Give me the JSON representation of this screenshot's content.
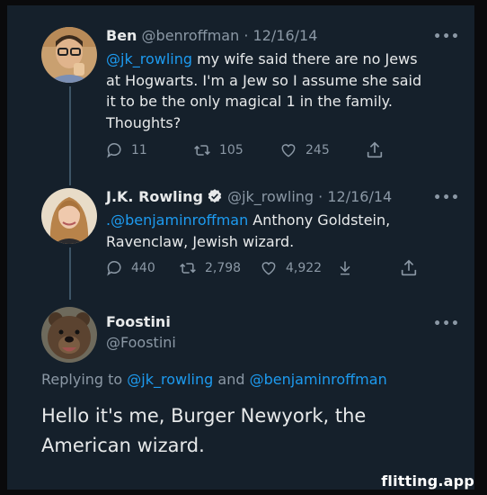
{
  "tweets": [
    {
      "name": "Ben",
      "handle": "@benroffman",
      "date": "· 12/16/14",
      "mention": "@jk_rowling",
      "text_line1": " my wife said there are no Jews",
      "text_line2": "at Hogwarts. I'm a Jew so I assume she said",
      "text_line3": "it to be the only magical 1 in the family.",
      "text_line4": "Thoughts?",
      "replies": "11",
      "retweets": "105",
      "likes": "245"
    },
    {
      "name": "J.K. Rowling",
      "handle": "@jk_rowling",
      "date": "· 12/16/14",
      "mention": ".@benjaminroffman",
      "text_line1": " Anthony Goldstein,",
      "text_line2": "Ravenclaw, Jewish wizard.",
      "replies": "440",
      "retweets": "2,798",
      "likes": "4,922"
    },
    {
      "name": "Foostini",
      "handle": "@Foostini",
      "replying_prefix": "Replying to ",
      "replying_user1": "@jk_rowling",
      "replying_and": " and ",
      "replying_user2": "@benjaminroffman",
      "text_line1": "Hello it's me, Burger Newyork, the",
      "text_line2": "American wizard."
    }
  ],
  "more_label": "•••",
  "watermark": "flitting.app",
  "colors": {
    "background": "#15202b",
    "link": "#1d9bf0",
    "muted": "#8b98a5",
    "verified": "#e7e9ea"
  },
  "icons": [
    "reply-icon",
    "retweet-icon",
    "like-icon",
    "share-icon",
    "download-icon",
    "verified-icon",
    "more-icon"
  ]
}
